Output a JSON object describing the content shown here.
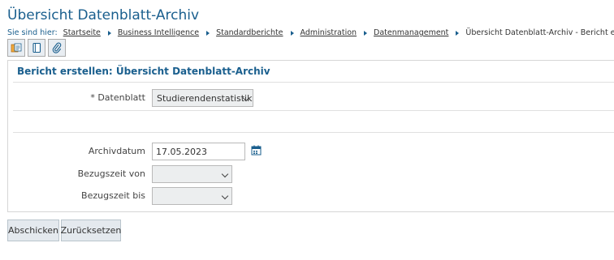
{
  "page": {
    "title": "Übersicht Datenblatt-Archiv"
  },
  "breadcrumb": {
    "prefix": "Sie sind hier:",
    "items": [
      "Startseite",
      "Business Intelligence",
      "Standardberichte",
      "Administration",
      "Datenmanagement"
    ],
    "current": "Übersicht Datenblatt-Archiv - Bericht erstellen"
  },
  "toolbar": {
    "icons": [
      "report-icon",
      "notebook-icon",
      "paperclip-icon"
    ]
  },
  "form": {
    "title": "Bericht erstellen: Übersicht Datenblatt-Archiv",
    "datenblatt": {
      "label": "* Datenblatt",
      "value": "Studierendenstatistik"
    },
    "archivdatum": {
      "label": "Archivdatum",
      "value": "17.05.2023"
    },
    "bezugszeit_von": {
      "label": "Bezugszeit von",
      "value": ""
    },
    "bezugszeit_bis": {
      "label": "Bezugszeit bis",
      "value": ""
    }
  },
  "actions": {
    "submit": "Abschicken",
    "reset": "Zurücksetzen"
  },
  "colors": {
    "accent": "#1a5f8e",
    "button_bg": "#e4e9ee"
  }
}
